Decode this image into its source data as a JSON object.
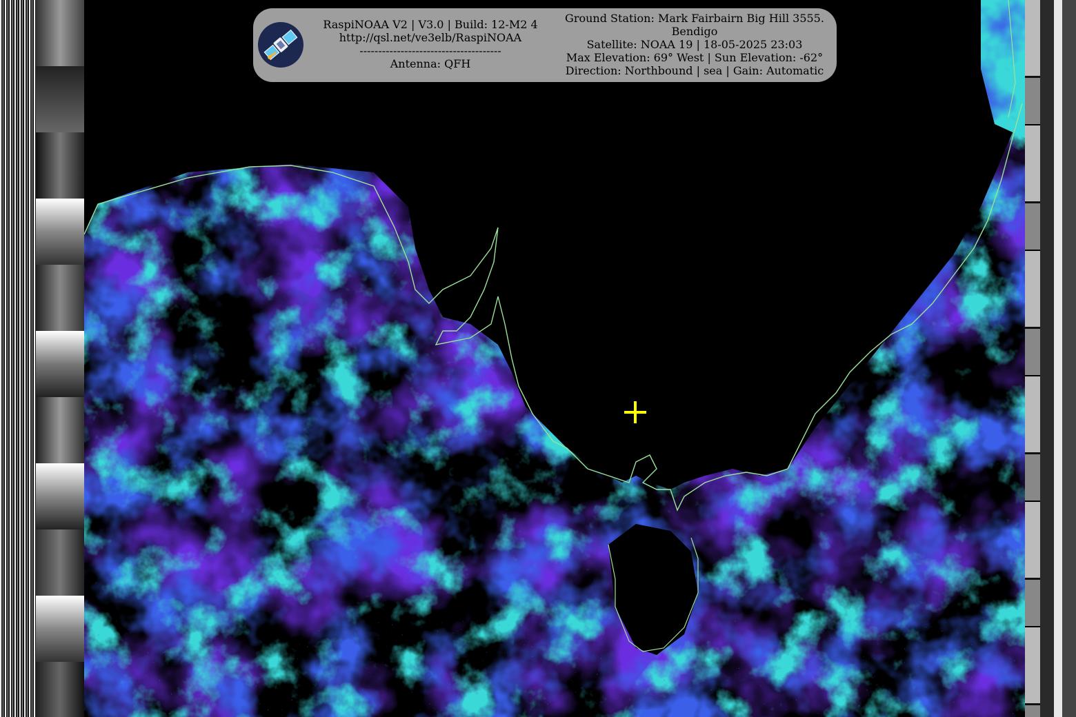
{
  "overlay": {
    "left_lines": [
      "RaspiNOAA V2 | V3.0 | Build: 12-M2 4",
      "http://qsl.net/ve3elb/RaspiNOAA",
      "--------------------------------------",
      "Antenna: QFH"
    ],
    "right_lines": [
      "Ground Station: Mark Fairbairn Big Hill 3555.",
      "Bendigo",
      "Satellite: NOAA 19 | 18-05-2025 23:03",
      "Max Elevation: 69° West | Sun Elevation: -62°",
      "Direction: Northbound | sea | Gain: Automatic"
    ]
  },
  "colors": {
    "overlay_bg": "#9e9e9e",
    "crosshair": "#ffff00",
    "coastline": "#9be29b",
    "cloud_cyan": "#3ad8d8",
    "cloud_blue": "#3a56e0",
    "cloud_purple": "#7a2ee0"
  },
  "icons": {
    "logo": "satellite-icon",
    "marker": "crosshair-icon"
  }
}
